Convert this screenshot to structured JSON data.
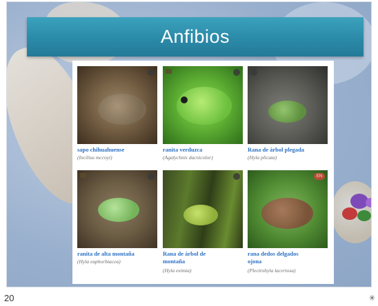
{
  "slide": {
    "title": "Anfibios",
    "number": "20"
  },
  "cards": [
    {
      "common": "sapo chihuahuense",
      "scientific": "(Incilius mccoyi)",
      "badge": ""
    },
    {
      "common": "ranita verduzca",
      "scientific": "(Agalychnis dacnicolor)",
      "badge": ""
    },
    {
      "common": "Rana de árbol plegada",
      "scientific": "(Hyla plicata)",
      "badge": ""
    },
    {
      "common": "ranita de alta montaña",
      "scientific": "(Hyla euphorbiacea)",
      "badge": ""
    },
    {
      "common": "Rana de árbol de montaña",
      "scientific": "(Hyla eximia)",
      "badge": ""
    },
    {
      "common": "rana dedos delgados ojona",
      "scientific": "(Plectrohyla lacertosa)",
      "badge": "EN"
    }
  ],
  "icons": {
    "status_marker": "✳"
  }
}
